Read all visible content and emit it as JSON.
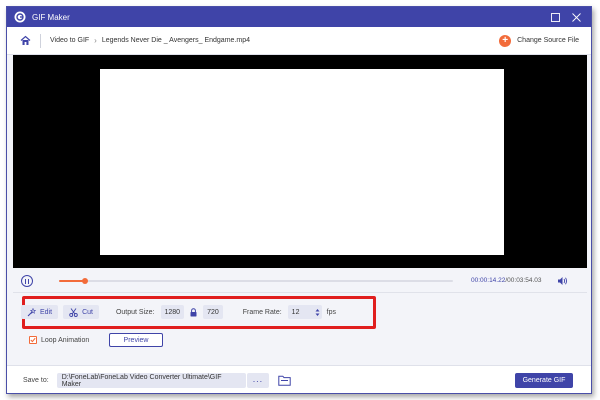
{
  "window": {
    "title": "GIF Maker"
  },
  "breadcrumb": {
    "section": "Video to GIF",
    "file": "Legends Never Die _ Avengers_ Endgame.mp4"
  },
  "header": {
    "change_source_label": "Change Source File"
  },
  "player": {
    "current_time": "00:00:14.22",
    "total_time": "00:03:54.03",
    "progress_fraction": 0.066
  },
  "tools": {
    "edit_label": "Edit",
    "cut_label": "Cut",
    "output_size_label": "Output Size:",
    "width": "1280",
    "height": "720",
    "frame_rate_label": "Frame Rate:",
    "frame_rate": "12",
    "fps_label": "fps"
  },
  "options": {
    "loop_label": "Loop Animation",
    "loop_checked": true,
    "preview_label": "Preview"
  },
  "footer": {
    "save_to_label": "Save to:",
    "save_path": "D:\\FoneLab\\FoneLab Video Converter Ultimate\\GIF Maker",
    "dots_label": "···",
    "generate_label": "Generate GIF"
  },
  "colors": {
    "accent": "#3f44a8",
    "highlight": "#f26b3a",
    "annotation": "#e01e1e"
  },
  "icons": [
    "app-logo-icon",
    "minimize-icon",
    "close-icon",
    "home-icon",
    "plus-circle-icon",
    "pause-icon",
    "volume-icon",
    "magic-wand-icon",
    "scissors-icon",
    "lock-icon",
    "stepper-icon",
    "check-icon",
    "folder-icon"
  ]
}
